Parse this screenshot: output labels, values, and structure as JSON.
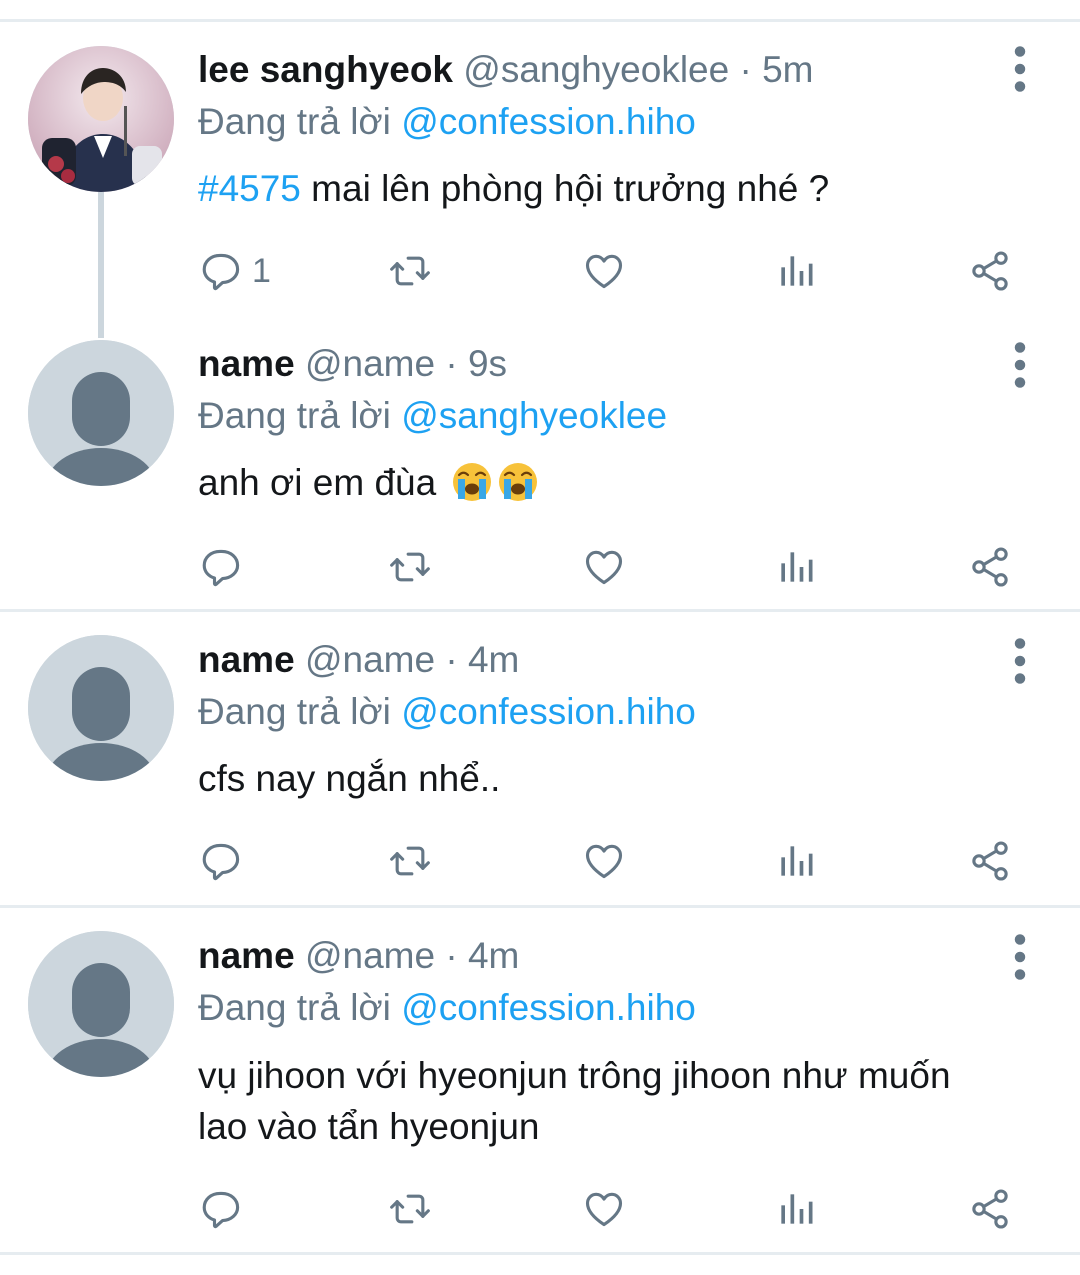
{
  "tweets": [
    {
      "name": "lee sanghyeok",
      "handle": "@sanghyeoklee",
      "separator": "·",
      "time": "5m",
      "reply_prefix": "Đang trả lời",
      "reply_to": "@confession.hiho",
      "hashtag": "#4575",
      "text": " mai lên phòng hội trưởng nhé ?",
      "reply_count": "1",
      "avatar": "photo"
    },
    {
      "name": "name",
      "handle": "@name",
      "separator": "·",
      "time": "9s",
      "reply_prefix": "Đang trả lời",
      "reply_to": "@sanghyeoklee",
      "text": "anh ơi em đùa",
      "emojis": [
        "loudly-crying-face",
        "loudly-crying-face"
      ],
      "avatar": "default"
    },
    {
      "name": "name",
      "handle": "@name",
      "separator": "·",
      "time": "4m",
      "reply_prefix": "Đang trả lời",
      "reply_to": "@confession.hiho",
      "text": "cfs nay ngắn nhể..",
      "avatar": "default"
    },
    {
      "name": "name",
      "handle": "@name",
      "separator": "·",
      "time": "4m",
      "reply_prefix": "Đang trả lời",
      "reply_to": "@confession.hiho",
      "text": "vụ jihoon với hyeonjun trông jihoon như muốn lao vào tẩn hyeonjun",
      "avatar": "default"
    }
  ],
  "icons": {
    "reply": "reply-icon",
    "retweet": "retweet-icon",
    "like": "heart-icon",
    "analytics": "analytics-icon",
    "share": "share-icon",
    "more": "more-vertical-icon"
  },
  "colors": {
    "link": "#1da1f2",
    "secondary": "#657786",
    "icon": "#657786",
    "divider": "#e6ecf0",
    "default_avatar_bg": "#ccd6dd",
    "default_avatar_fg": "#657786"
  }
}
